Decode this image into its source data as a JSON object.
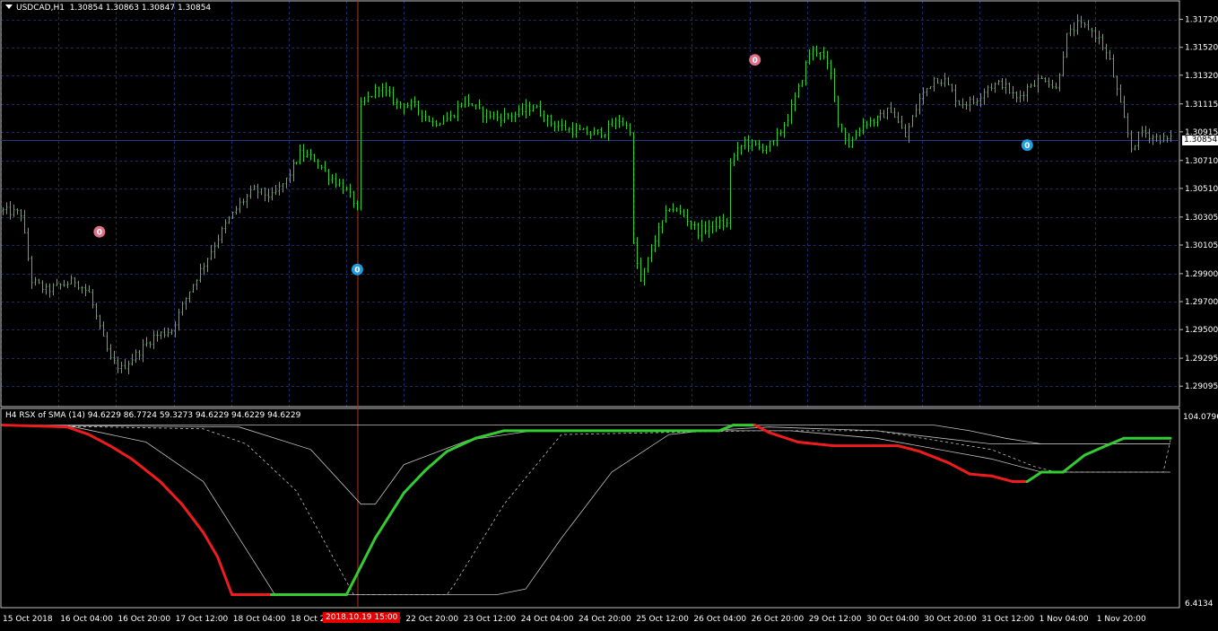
{
  "main_chart": {
    "symbol": "USDCAD,H1",
    "ohlc": "1.30854 1.30863 1.30847 1.30854",
    "current_price_tag": "1.30854",
    "price_ticks": [
      "1.31720",
      "1.31520",
      "1.31320",
      "1.31115",
      "1.30915",
      "1.30710",
      "1.30510",
      "1.30305",
      "1.30105",
      "1.29900",
      "1.29700",
      "1.29500",
      "1.29295",
      "1.29095"
    ],
    "colors": {
      "candles": "#33cc33",
      "grid": "#1e2a6e",
      "border": "#c0c0c0",
      "bid_line": "#27378a",
      "vline": "#b03020"
    },
    "markers": [
      {
        "label": "0",
        "color": "#e07088",
        "index": 27,
        "price": 1.302
      },
      {
        "label": "0",
        "color": "#1e9ee0",
        "index": 99,
        "price": 1.2993
      },
      {
        "label": "0",
        "color": "#e07088",
        "index": 210,
        "price": 1.3143
      },
      {
        "label": "0",
        "color": "#1e9ee0",
        "index": 286,
        "price": 1.3082
      }
    ]
  },
  "indicator": {
    "title": "H4 RSX of SMA (14) 94.6229 86.7724 59.3273 94.6229 94.6229 94.6229",
    "scale_max": "104.0796",
    "scale_min": "6.4134",
    "colors": {
      "up": "#33cc33",
      "down": "#ee1c1c",
      "lines": "#c0c0c0"
    }
  },
  "time_axis": {
    "labels": [
      "15 Oct 2018",
      "16 Oct 04:00",
      "16 Oct 20:00",
      "17 Oct 12:00",
      "18 Oct 04:00",
      "18 Oct 2",
      "22 Oct 04:00",
      "22 Oct 20:00",
      "23 Oct 12:00",
      "24 Oct 04:00",
      "24 Oct 20:00",
      "25 Oct 12:00",
      "26 Oct 04:00",
      "26 Oct 20:00",
      "29 Oct 12:00",
      "30 Oct 04:00",
      "30 Oct 20:00",
      "31 Oct 12:00",
      "1 Nov 04:00",
      "1 Nov 20:00"
    ],
    "highlight_label": "2018.10.19 15:00"
  },
  "chart_data": [
    {
      "type": "candlestick",
      "title": "USDCAD,H1",
      "ylim": [
        1.29,
        1.3182
      ],
      "price_anchors": [
        [
          0,
          1.3035
        ],
        [
          5,
          1.3033
        ],
        [
          8,
          1.2985
        ],
        [
          12,
          1.2978
        ],
        [
          20,
          1.2985
        ],
        [
          24,
          1.2976
        ],
        [
          27,
          1.295
        ],
        [
          30,
          1.2928
        ],
        [
          33,
          1.2922
        ],
        [
          37,
          1.2932
        ],
        [
          42,
          1.2945
        ],
        [
          47,
          1.295
        ],
        [
          52,
          1.2978
        ],
        [
          57,
          1.3002
        ],
        [
          62,
          1.3025
        ],
        [
          66,
          1.304
        ],
        [
          70,
          1.305
        ],
        [
          75,
          1.3045
        ],
        [
          79,
          1.3057
        ],
        [
          83,
          1.3076
        ],
        [
          87,
          1.3072
        ],
        [
          91,
          1.306
        ],
        [
          95,
          1.3052
        ],
        [
          98,
          1.3042
        ],
        [
          99,
          1.3035
        ],
        [
          100,
          1.311
        ],
        [
          105,
          1.3124
        ],
        [
          110,
          1.3112
        ],
        [
          115,
          1.311
        ],
        [
          120,
          1.3098
        ],
        [
          125,
          1.3102
        ],
        [
          129,
          1.3115
        ],
        [
          133,
          1.3106
        ],
        [
          138,
          1.3102
        ],
        [
          143,
          1.3104
        ],
        [
          148,
          1.311
        ],
        [
          153,
          1.3098
        ],
        [
          158,
          1.3093
        ],
        [
          164,
          1.309
        ],
        [
          168,
          1.3092
        ],
        [
          172,
          1.31
        ],
        [
          175,
          1.3093
        ],
        [
          176,
          1.301
        ],
        [
          178,
          1.2984
        ],
        [
          182,
          1.3015
        ],
        [
          186,
          1.3038
        ],
        [
          190,
          1.3032
        ],
        [
          194,
          1.302
        ],
        [
          199,
          1.3026
        ],
        [
          202,
          1.3025
        ],
        [
          203,
          1.307
        ],
        [
          207,
          1.3085
        ],
        [
          211,
          1.308
        ],
        [
          215,
          1.3083
        ],
        [
          219,
          1.3102
        ],
        [
          222,
          1.3122
        ],
        [
          225,
          1.3148
        ],
        [
          228,
          1.315
        ],
        [
          231,
          1.3132
        ],
        [
          233,
          1.31
        ],
        [
          236,
          1.3082
        ],
        [
          240,
          1.3098
        ],
        [
          244,
          1.31
        ],
        [
          248,
          1.3108
        ],
        [
          252,
          1.3088
        ],
        [
          256,
          1.3115
        ],
        [
          260,
          1.313
        ],
        [
          263,
          1.3128
        ],
        [
          267,
          1.3112
        ],
        [
          271,
          1.3113
        ],
        [
          275,
          1.3124
        ],
        [
          279,
          1.3126
        ],
        [
          283,
          1.3115
        ],
        [
          287,
          1.3126
        ],
        [
          291,
          1.313
        ],
        [
          294,
          1.3122
        ],
        [
          297,
          1.316
        ],
        [
          300,
          1.3168
        ],
        [
          303,
          1.3166
        ],
        [
          306,
          1.3158
        ],
        [
          309,
          1.3142
        ],
        [
          312,
          1.311
        ],
        [
          315,
          1.308
        ],
        [
          318,
          1.3092
        ],
        [
          321,
          1.3088
        ],
        [
          325,
          1.3086
        ]
      ]
    },
    {
      "type": "line",
      "title": "H4 RSX of SMA (14)",
      "ylim": [
        6.4134,
        104.0796
      ],
      "series": [
        {
          "role": "rsx",
          "values": [
            [
              0,
              100
            ],
            [
              18,
              99
            ],
            [
              24,
              95
            ],
            [
              30,
              89
            ],
            [
              36,
              82
            ],
            [
              44,
              70
            ],
            [
              50,
              58
            ],
            [
              56,
              43
            ],
            [
              60,
              30
            ],
            [
              64,
              10
            ],
            [
              75,
              10
            ],
            [
              96,
              10
            ],
            [
              100,
              25
            ],
            [
              104,
              40
            ],
            [
              108,
              52
            ],
            [
              112,
              64
            ],
            [
              118,
              76
            ],
            [
              124,
              86
            ],
            [
              132,
              93
            ],
            [
              140,
              97
            ],
            [
              200,
              97
            ],
            [
              204,
              100
            ],
            [
              210,
              100
            ],
            [
              214,
              96
            ],
            [
              222,
              91
            ],
            [
              232,
              89
            ],
            [
              250,
              89
            ],
            [
              256,
              86
            ],
            [
              264,
              80
            ],
            [
              270,
              74
            ],
            [
              276,
              73
            ],
            [
              282,
              70
            ],
            [
              286,
              70
            ],
            [
              290,
              75
            ],
            [
              296,
              75
            ],
            [
              302,
              84
            ],
            [
              308,
              89
            ],
            [
              313,
              93
            ],
            [
              326,
              93
            ]
          ]
        },
        {
          "role": "upper",
          "values": [
            [
              0,
              100
            ],
            [
              200,
              100
            ],
            [
              210,
              100
            ],
            [
              260,
              100
            ],
            [
              270,
              97
            ],
            [
              280,
              93
            ],
            [
              290,
              90
            ],
            [
              326,
              90
            ]
          ]
        },
        {
          "role": "level-thin-1",
          "values": [
            [
              0,
              100
            ],
            [
              20,
              99
            ],
            [
              40,
              91
            ],
            [
              56,
              70
            ],
            [
              70,
              28
            ],
            [
              76,
              10
            ],
            [
              96,
              10
            ],
            [
              122,
              10
            ],
            [
              138,
              10
            ],
            [
              146,
              13
            ],
            [
              156,
              40
            ],
            [
              170,
              75
            ],
            [
              186,
              95
            ],
            [
              196,
              97
            ],
            [
              220,
              97
            ],
            [
              244,
              93
            ],
            [
              276,
              82
            ],
            [
              290,
              75
            ],
            [
              326,
              75
            ]
          ]
        },
        {
          "role": "level-thin-2",
          "values": [
            [
              0,
              100
            ],
            [
              56,
              98
            ],
            [
              68,
              90
            ],
            [
              82,
              65
            ],
            [
              98,
              10
            ],
            [
              124,
              10
            ],
            [
              126,
              15
            ],
            [
              140,
              58
            ],
            [
              146,
              72
            ],
            [
              156,
              95
            ],
            [
              210,
              97
            ],
            [
              244,
              97
            ],
            [
              276,
              87
            ],
            [
              288,
              78
            ],
            [
              294,
              75
            ],
            [
              324,
              75
            ],
            [
              326,
              92
            ]
          ]
        },
        {
          "role": "level-thin-3",
          "values": [
            [
              0,
              100
            ],
            [
              66,
              99
            ],
            [
              86,
              87
            ],
            [
              100,
              58
            ],
            [
              104,
              58
            ],
            [
              112,
              79
            ],
            [
              130,
              92
            ],
            [
              148,
              97
            ],
            [
              196,
              97
            ],
            [
              214,
              99
            ],
            [
              244,
              97
            ],
            [
              276,
              90
            ],
            [
              326,
              90
            ]
          ]
        }
      ]
    }
  ]
}
